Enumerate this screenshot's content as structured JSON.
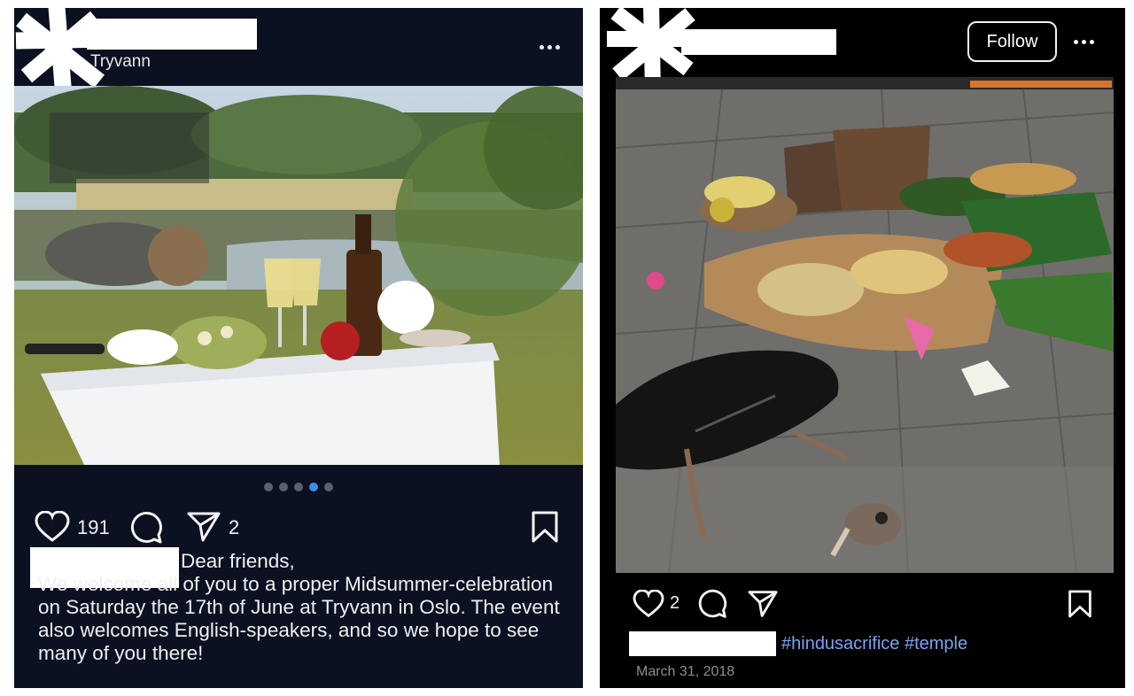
{
  "left_post": {
    "location": "Tryvann",
    "photo_description_icon": "midsummer-table-photo",
    "carousel": {
      "total": 5,
      "active_index": 3
    },
    "likes": "191",
    "shares": "2",
    "caption_first_line": "Dear friends,",
    "caption_body": "We welcome all of you to a proper Midsummer-celebration on Saturday the 17th of June at Tryvann in Oslo. The event also welcomes English-speakers, and so we hope to see many of you there!"
  },
  "right_post": {
    "follow_label": "Follow",
    "likes": "2",
    "hashtags": "#hindusacrifice #temple",
    "date": "March 31, 2018"
  },
  "icons": [
    "heart-icon",
    "comment-icon",
    "share-icon",
    "bookmark-icon",
    "more-icon"
  ],
  "colors": {
    "left_bg": "#0b1120",
    "right_bg": "#000000",
    "carousel_active": "#3b8ef2",
    "hashtag": "#7aa3ee",
    "date": "#8d8d8d"
  }
}
